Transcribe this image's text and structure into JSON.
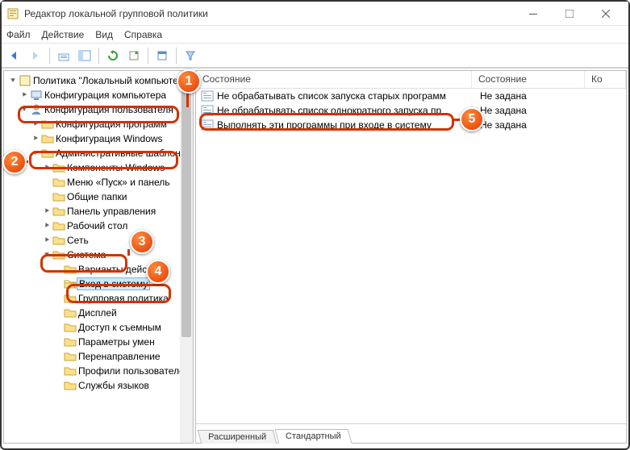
{
  "window": {
    "title": "Редактор локальной групповой политики"
  },
  "menu": {
    "file": "Файл",
    "action": "Действие",
    "view": "Вид",
    "help": "Справка"
  },
  "tree": {
    "root": "Политика \"Локальный компьютер\"",
    "comp_conf": "Конфигурация компьютера",
    "user_conf": "Конфигурация пользователя",
    "soft_conf": "Конфигурация программ",
    "win_conf": "Конфигурация Windows",
    "admin_templates": "Административные шаблоны",
    "win_components": "Компоненты Windows",
    "start_menu": "Меню «Пуск» и панель",
    "shared_folders": "Общие папки",
    "control_panel": "Панель управления",
    "desktop": "Рабочий стол",
    "network": "Сеть",
    "system": "Система",
    "action_opts": "Варианты действий",
    "logon": "Вход в систему",
    "group_policy": "Групповая политика",
    "display": "Дисплей",
    "removable": "Доступ к съемным",
    "smart_params": "Параметры умен",
    "redirect": "Перенаправление",
    "user_profiles": "Профили пользователей",
    "lang_svcs": "Службы языков"
  },
  "columns": {
    "state": "Состояние",
    "state2": "Состояние",
    "k": "Ко"
  },
  "rows": {
    "r1": "Не обрабатывать список запуска старых программ",
    "r2": "Не обрабатывать список однократного запуска пр",
    "r3": "Выполнять эти программы при входе в систему",
    "not_set": "Не задана"
  },
  "tabs": {
    "extended": "Расширенный",
    "standard": "Стандартный"
  },
  "callouts": {
    "c1": "1",
    "c2": "2",
    "c3": "3",
    "c4": "4",
    "c5": "5"
  }
}
